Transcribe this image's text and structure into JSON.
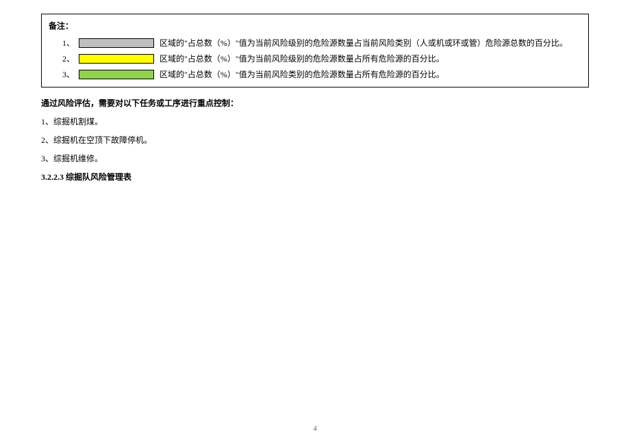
{
  "remarks": {
    "title": "备注：",
    "items": [
      {
        "index": "1、",
        "color": "#bfbfbf",
        "text": "区域的\"占总数（%）\"值为当前风险级别的危险源数量占当前风险类别（人或机或环或管）危险源总数的百分比。"
      },
      {
        "index": "2、",
        "color": "#ffff00",
        "text": "区域的\"占总数（%）\"值为当前风险级别的危险源数量占所有危险源的百分比。"
      },
      {
        "index": "3、",
        "color": "#92d050",
        "text": "区域的\"占总数（%）\"值为当前风险类别的危险源数量占所有危险源的百分比。"
      }
    ]
  },
  "sectionTitle": "通过风险评估，需要对以下任务或工序进行重点控制：",
  "tasks": [
    "1、综掘机割煤。",
    "2、综掘机在空顶下故障停机。",
    "3、综掘机维修。"
  ],
  "subheading": "3.2.2.3 综掘队风险管理表",
  "pageNumber": "4"
}
